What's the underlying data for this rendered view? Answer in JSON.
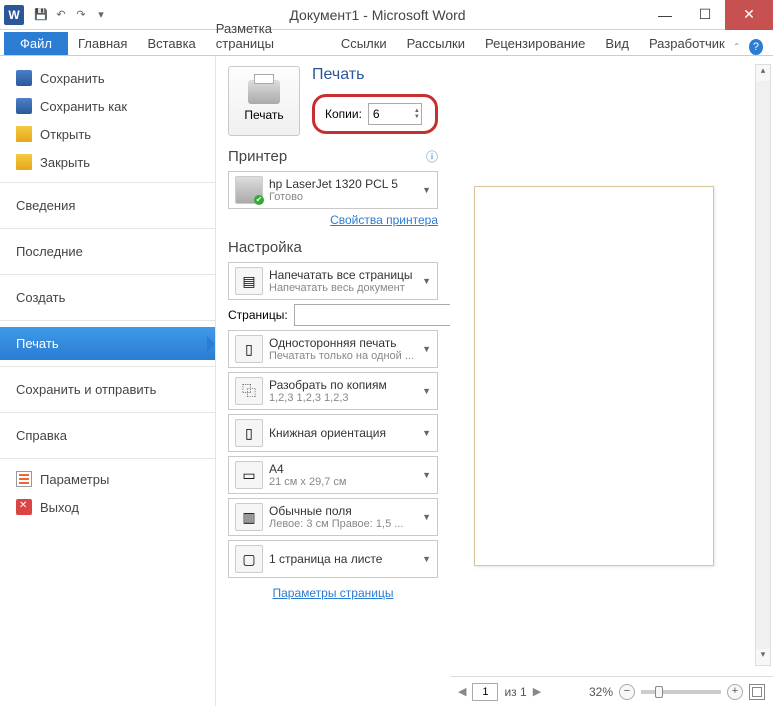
{
  "title": "Документ1 - Microsoft Word",
  "app_letter": "W",
  "ribbon": {
    "file": "Файл",
    "tabs": [
      "Главная",
      "Вставка",
      "Разметка страницы",
      "Ссылки",
      "Рассылки",
      "Рецензирование",
      "Вид",
      "Разработчик"
    ]
  },
  "nav": {
    "save": "Сохранить",
    "saveas": "Сохранить как",
    "open": "Открыть",
    "close": "Закрыть",
    "info": "Сведения",
    "recent": "Последние",
    "new": "Создать",
    "print": "Печать",
    "share": "Сохранить и отправить",
    "help": "Справка",
    "options": "Параметры",
    "exit": "Выход"
  },
  "print": {
    "heading": "Печать",
    "button": "Печать",
    "copies_label": "Копии:",
    "copies_value": "6"
  },
  "printer": {
    "section": "Принтер",
    "name": "hp LaserJet 1320 PCL 5",
    "status": "Готово",
    "props_link": "Свойства принтера"
  },
  "settings": {
    "section": "Настройка",
    "range_main": "Напечатать все страницы",
    "range_sub": "Напечатать весь документ",
    "pages_label": "Страницы:",
    "pages_value": "",
    "sides_main": "Односторонняя печать",
    "sides_sub": "Печатать только на одной ...",
    "collate_main": "Разобрать по копиям",
    "collate_sub": "1,2,3   1,2,3   1,2,3",
    "orient_main": "Книжная ориентация",
    "paper_main": "A4",
    "paper_sub": "21 см x 29,7 см",
    "margins_main": "Обычные поля",
    "margins_sub": "Левое: 3 см   Правое: 1,5 ...",
    "sheet_main": "1 страница на листе",
    "page_setup": "Параметры страницы"
  },
  "status": {
    "page_cur": "1",
    "page_of": "из 1",
    "zoom": "32%"
  }
}
